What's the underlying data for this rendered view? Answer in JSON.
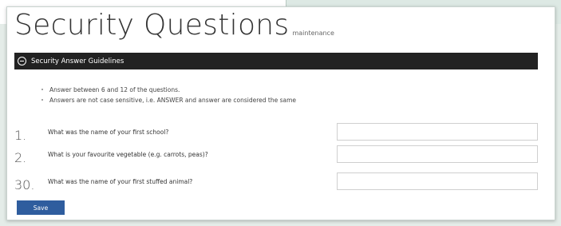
{
  "page": {
    "title": "Security Questions",
    "subtitle": "maintenance"
  },
  "guidelines_section": {
    "header_label": "Security Answer Guidelines",
    "items": [
      "Answer between 6 and 12 of the questions.",
      "Answers are not case sensitive, i.e. ANSWER and answer are considered the same"
    ]
  },
  "questions": [
    {
      "number": "1.",
      "text": "What was the name of your first school?",
      "answer": ""
    },
    {
      "number": "2.",
      "text": "What is your favourite vegetable (e.g. carrots, peas)?",
      "answer": ""
    },
    {
      "number": "30.",
      "text": "What was the name of your first stuffed animal?",
      "answer": ""
    }
  ],
  "actions": {
    "save_label": "Save"
  },
  "colors": {
    "section_bar": "#222222",
    "save_button": "#2f5d9e"
  }
}
